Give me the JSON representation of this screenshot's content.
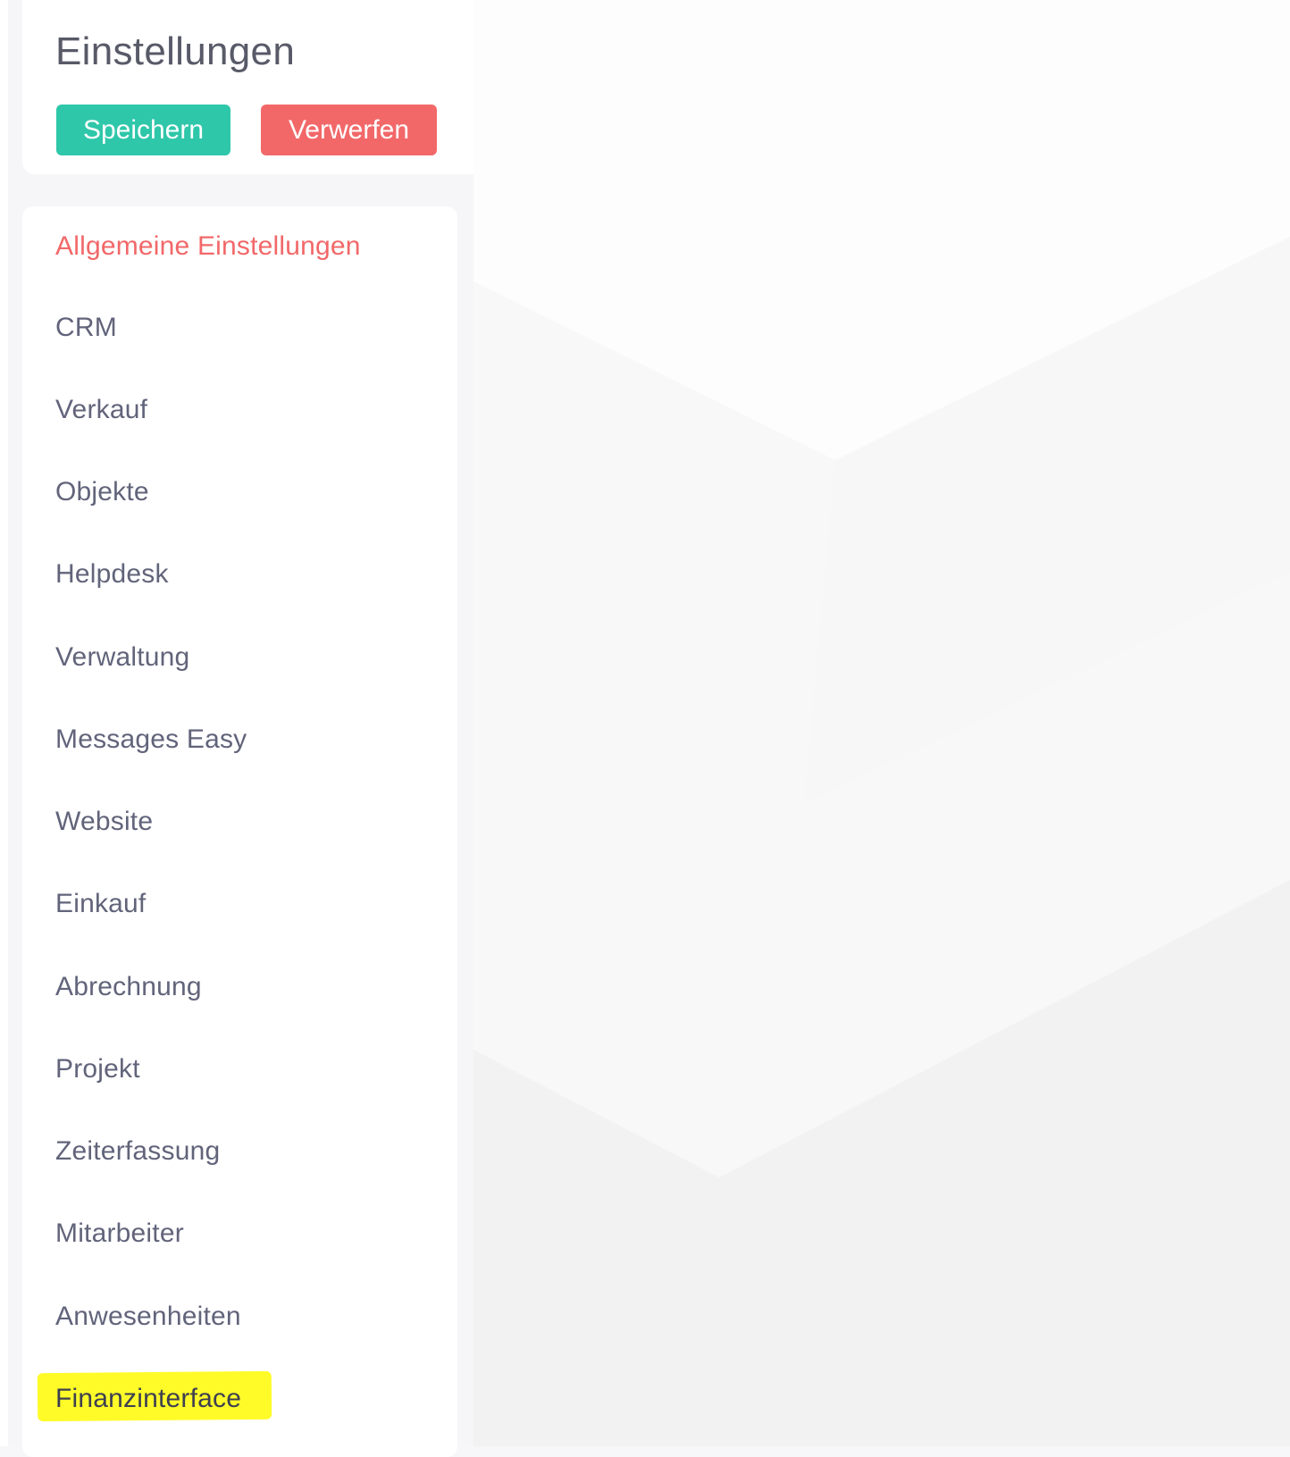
{
  "header": {
    "title": "Einstellungen",
    "save_label": "Speichern",
    "discard_label": "Verwerfen"
  },
  "nav": {
    "items": [
      {
        "label": "Allgemeine Einstellungen",
        "state": "active"
      },
      {
        "label": "CRM"
      },
      {
        "label": "Verkauf"
      },
      {
        "label": "Objekte"
      },
      {
        "label": "Helpdesk"
      },
      {
        "label": "Verwaltung"
      },
      {
        "label": "Messages Easy"
      },
      {
        "label": "Website"
      },
      {
        "label": "Einkauf"
      },
      {
        "label": "Abrechnung"
      },
      {
        "label": "Projekt"
      },
      {
        "label": "Zeiterfassung"
      },
      {
        "label": "Mitarbeiter"
      },
      {
        "label": "Anwesenheiten"
      },
      {
        "label": "Finanzinterface",
        "state": "highlighted"
      }
    ]
  },
  "colors": {
    "save": "#2fc7aa",
    "discard": "#f26869",
    "active_item": "#f26869",
    "highlight": "#fffb1e"
  }
}
